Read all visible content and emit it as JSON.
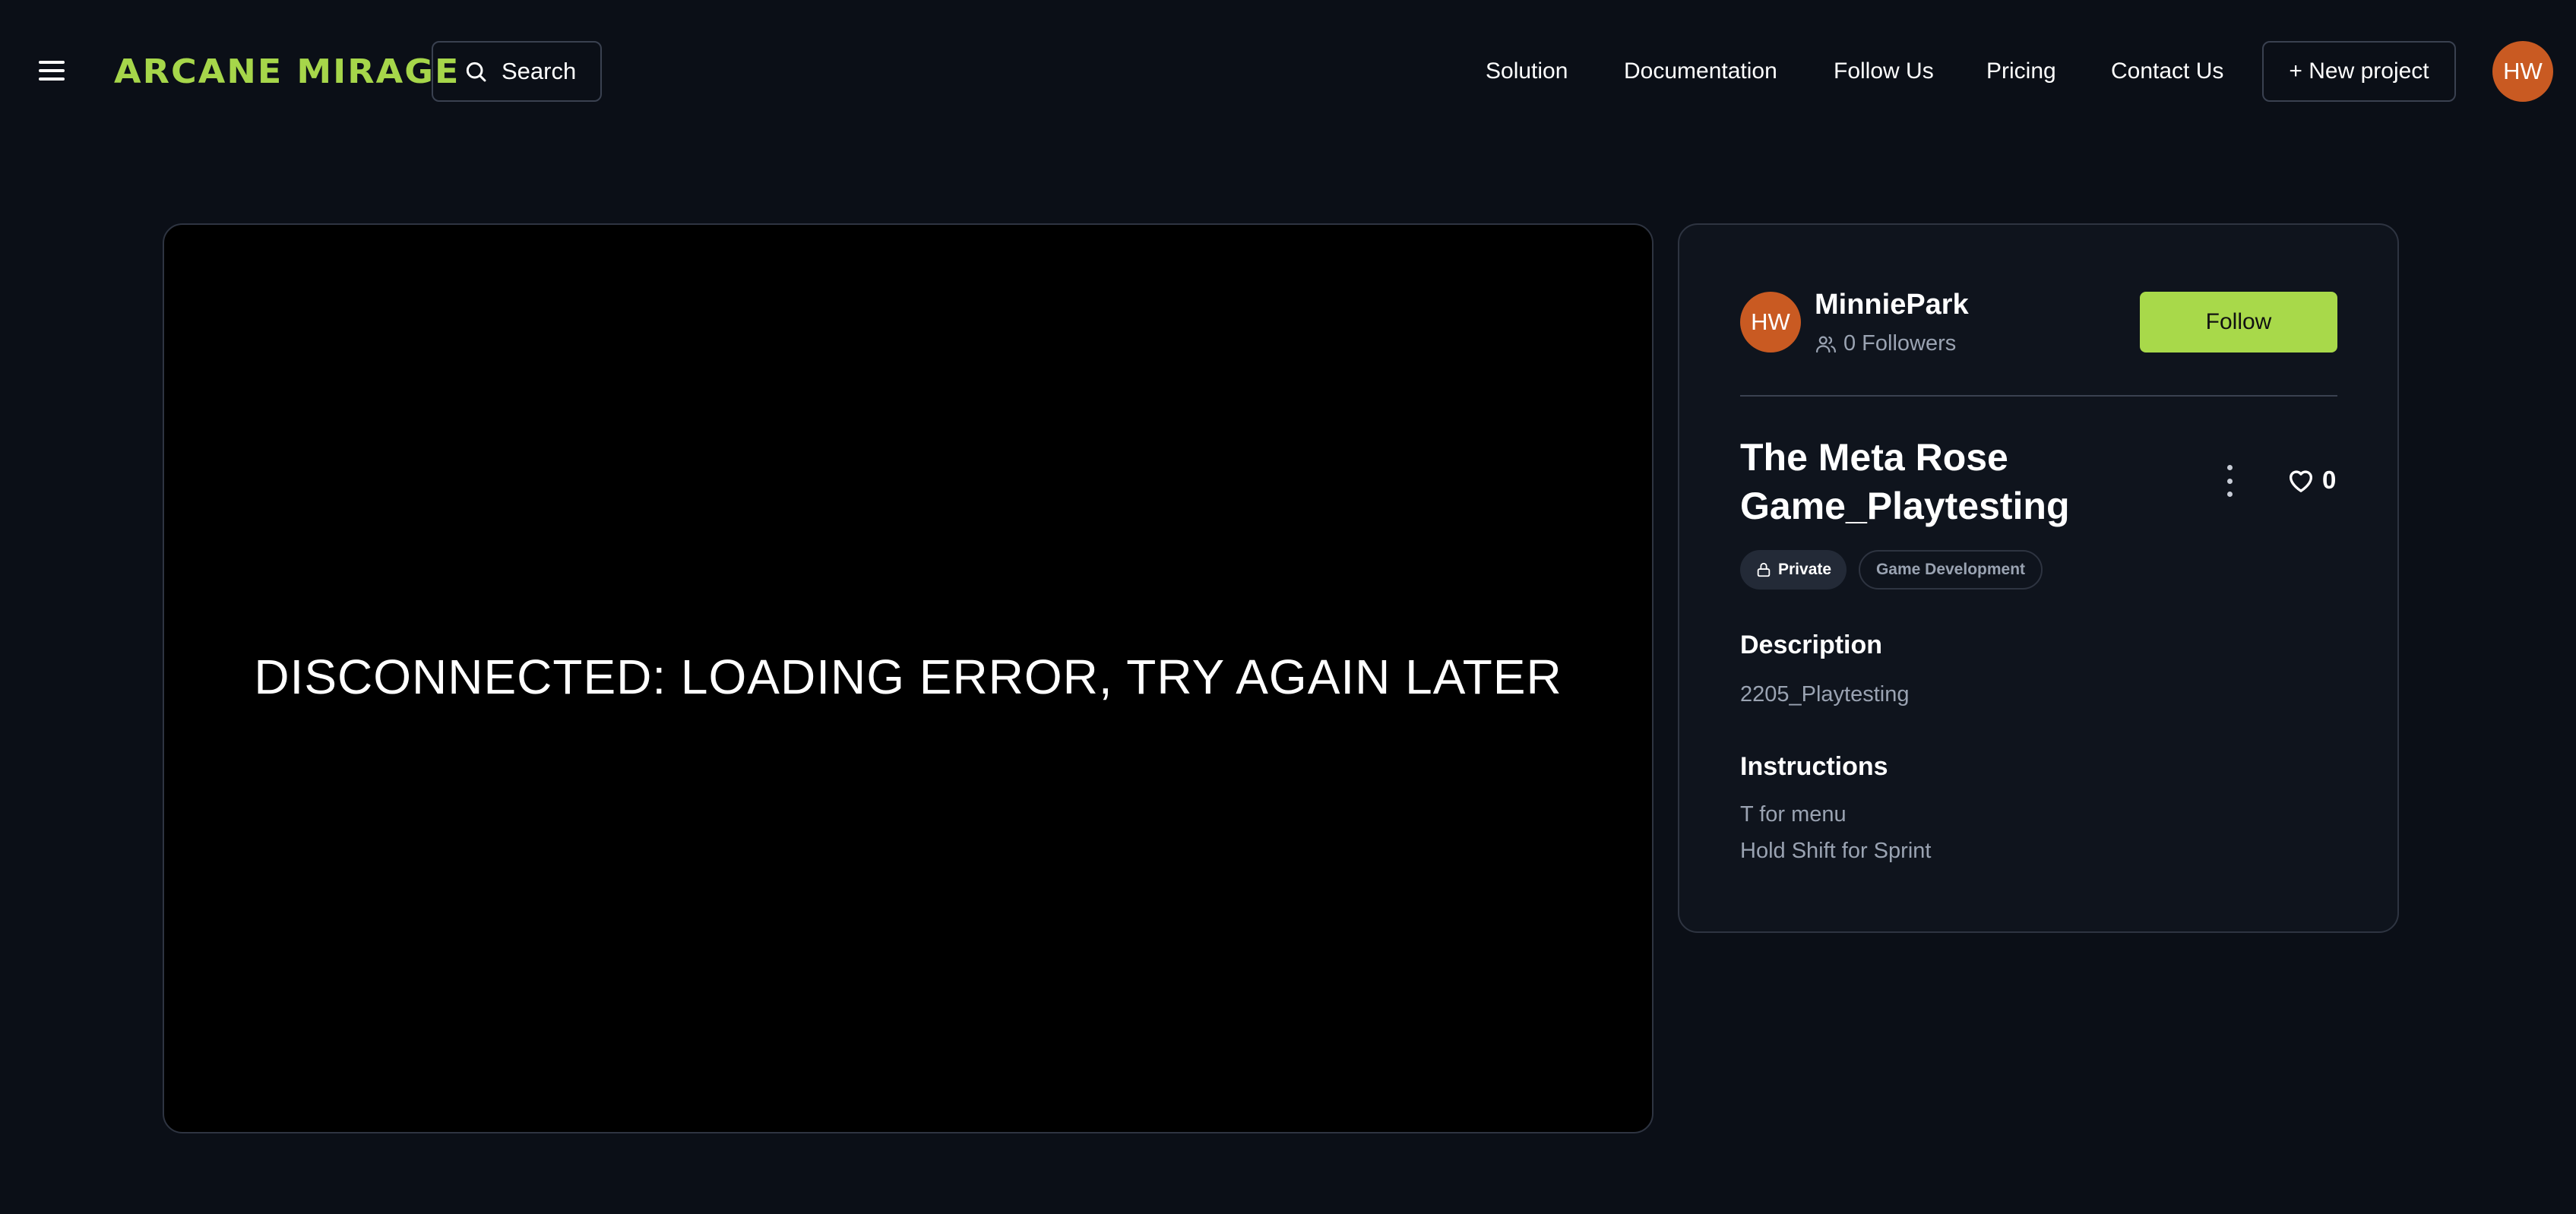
{
  "header": {
    "logo_text": "ARCANE MIRAGE",
    "search_label": "Search",
    "nav": [
      "Solution",
      "Documentation",
      "Follow Us",
      "Pricing",
      "Contact Us"
    ],
    "new_project_label": "+ New project",
    "user_initials": "HW"
  },
  "game": {
    "status_message": "DISCONNECTED: LOADING ERROR, TRY AGAIN LATER"
  },
  "panel": {
    "owner": {
      "initials": "HW",
      "name": "MinniePark",
      "followers": "0 Followers"
    },
    "follow_label": "Follow",
    "title_line1": "The Meta Rose",
    "title_line2": "Game_Playtesting",
    "likes": "0",
    "badges": {
      "visibility": "Private",
      "category": "Game Development"
    },
    "description": {
      "heading": "Description",
      "text": "2205_Playtesting"
    },
    "instructions": {
      "heading": "Instructions",
      "lines": [
        "T for menu",
        "Hold Shift for Sprint"
      ]
    }
  },
  "colors": {
    "background": "#0b0f17",
    "accent": "#a8d94a",
    "avatar": "#c95a22"
  }
}
